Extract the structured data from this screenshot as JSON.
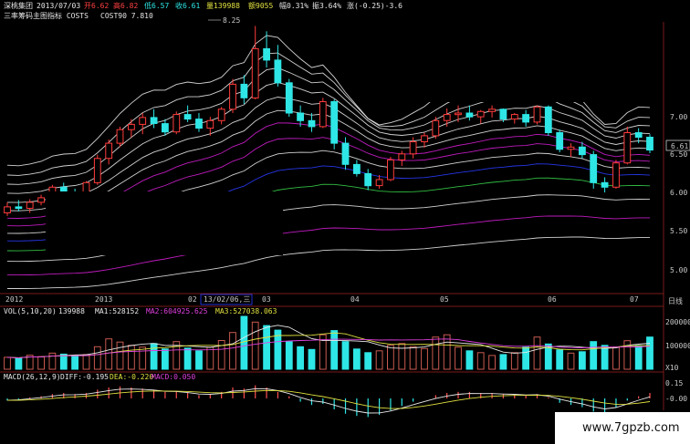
{
  "header": {
    "stock_name": "深桃集团",
    "date": "2013/07/03",
    "open": "开6.62",
    "high": "高6.82",
    "low": "低6.57",
    "close": "收6.61",
    "volume": "量139988",
    "amount": "额9055",
    "change": "幅0.31%",
    "amplitude": "振3.64%",
    "change_amt": "涨(-0.25)-3.6",
    "indicator_title": "三率筹码主图指标 COSTS",
    "cost_value": "COST90 7.810"
  },
  "price_panel": {
    "y_ticks": [
      "7.00",
      "6.50",
      "6.00",
      "5.50",
      "5.00"
    ],
    "current_price": "6.61",
    "peak_label": "8.25",
    "axis_label": "日线",
    "colors": {
      "up": "#ff3b3b",
      "down": "#2ee6e6",
      "ribbon_white": "#e8e8e8",
      "ribbon_magenta": "#d21ed2",
      "ribbon_blue": "#2a3cff",
      "ribbon_green": "#37d14a"
    }
  },
  "time_axis": {
    "labels": [
      "2012",
      "2013",
      "02",
      "13/02/06,三",
      "03",
      "04",
      "05",
      "06",
      "07"
    ]
  },
  "volume_panel": {
    "legend": {
      "label": "VOL(5,10,20)",
      "vol": "139988",
      "ma1": "MA1:528152",
      "ma2": "MA2:604925.625",
      "ma3": "MA3:527038.063"
    },
    "y_ticks": [
      "200000",
      "100000",
      "X10"
    ]
  },
  "macd_panel": {
    "legend": {
      "label": "MACD(26,12,9)",
      "diff": "DIFF:-0.195",
      "dea": "DEA:-0.220",
      "macd": "MACD:0.050"
    },
    "y_ticks": [
      "0.15",
      "-0.00"
    ]
  },
  "watermark": "www.7gpzb.com",
  "chart_data": [
    {
      "type": "candlestick",
      "title": "三率筹码主图指标 COSTS",
      "ylim": [
        4.75,
        7.55
      ],
      "ohlc": [
        [
          5.78,
          5.92,
          5.74,
          5.86
        ],
        [
          5.86,
          5.95,
          5.8,
          5.84
        ],
        [
          5.84,
          5.96,
          5.78,
          5.92
        ],
        [
          5.92,
          6.02,
          5.88,
          5.98
        ],
        [
          5.98,
          6.15,
          5.94,
          6.12
        ],
        [
          6.12,
          6.18,
          6.02,
          6.06
        ],
        [
          6.05,
          6.1,
          5.96,
          6.03
        ],
        [
          6.03,
          6.2,
          6.0,
          6.18
        ],
        [
          6.18,
          6.55,
          6.15,
          6.5
        ],
        [
          6.5,
          6.75,
          6.42,
          6.7
        ],
        [
          6.7,
          6.92,
          6.65,
          6.88
        ],
        [
          6.88,
          7.02,
          6.78,
          6.95
        ],
        [
          6.95,
          7.1,
          6.82,
          7.04
        ],
        [
          7.04,
          7.15,
          6.9,
          6.96
        ],
        [
          6.96,
          7.02,
          6.8,
          6.85
        ],
        [
          6.85,
          7.12,
          6.82,
          7.08
        ],
        [
          7.08,
          7.2,
          6.98,
          7.02
        ],
        [
          7.02,
          7.1,
          6.85,
          6.9
        ],
        [
          6.9,
          7.05,
          6.8,
          7.0
        ],
        [
          7.0,
          7.18,
          6.95,
          7.15
        ],
        [
          7.15,
          7.55,
          7.1,
          7.48
        ],
        [
          7.48,
          7.6,
          7.22,
          7.3
        ],
        [
          7.3,
          8.25,
          7.28,
          7.95
        ],
        [
          7.95,
          8.18,
          7.7,
          7.8
        ],
        [
          7.8,
          8.0,
          7.45,
          7.5
        ],
        [
          7.5,
          7.55,
          7.05,
          7.1
        ],
        [
          7.1,
          7.2,
          6.92,
          7.0
        ],
        [
          7.0,
          7.1,
          6.85,
          6.92
        ],
        [
          6.92,
          7.3,
          6.9,
          7.25
        ],
        [
          7.25,
          7.28,
          6.62,
          6.7
        ],
        [
          6.7,
          6.78,
          6.35,
          6.42
        ],
        [
          6.42,
          6.48,
          6.26,
          6.3
        ],
        [
          6.3,
          6.36,
          6.08,
          6.14
        ],
        [
          6.14,
          6.28,
          6.1,
          6.22
        ],
        [
          6.22,
          6.52,
          6.2,
          6.48
        ],
        [
          6.48,
          6.6,
          6.4,
          6.56
        ],
        [
          6.56,
          6.78,
          6.5,
          6.72
        ],
        [
          6.72,
          6.84,
          6.64,
          6.8
        ],
        [
          6.8,
          7.05,
          6.76,
          7.0
        ],
        [
          7.0,
          7.16,
          6.92,
          7.08
        ],
        [
          7.08,
          7.2,
          6.98,
          7.1
        ],
        [
          7.1,
          7.2,
          7.0,
          7.05
        ],
        [
          7.05,
          7.14,
          6.96,
          7.12
        ],
        [
          7.12,
          7.2,
          7.04,
          7.15
        ],
        [
          7.15,
          7.16,
          6.98,
          7.02
        ],
        [
          7.02,
          7.1,
          6.96,
          7.08
        ],
        [
          7.08,
          7.14,
          6.92,
          6.98
        ],
        [
          6.98,
          7.2,
          6.95,
          7.18
        ],
        [
          7.18,
          7.2,
          6.8,
          6.84
        ],
        [
          6.84,
          6.88,
          6.58,
          6.62
        ],
        [
          6.62,
          6.7,
          6.52,
          6.65
        ],
        [
          6.65,
          6.72,
          6.5,
          6.55
        ],
        [
          6.55,
          6.6,
          6.1,
          6.18
        ],
        [
          6.18,
          6.25,
          6.05,
          6.12
        ],
        [
          6.12,
          6.48,
          6.1,
          6.44
        ],
        [
          6.44,
          6.92,
          6.42,
          6.84
        ],
        [
          6.84,
          6.9,
          6.7,
          6.78
        ],
        [
          6.78,
          6.82,
          6.57,
          6.61
        ]
      ]
    },
    {
      "type": "bar",
      "title": "VOL(5,10,20)",
      "values": [
        52000,
        48000,
        61000,
        55000,
        70000,
        66000,
        60000,
        64000,
        98000,
        132000,
        118000,
        104000,
        96000,
        112000,
        88000,
        120000,
        92000,
        80000,
        96000,
        125000,
        160000,
        230000,
        205000,
        190000,
        170000,
        120000,
        98000,
        86000,
        150000,
        168000,
        120000,
        88000,
        72000,
        80000,
        104000,
        112000,
        98000,
        90000,
        140000,
        150000,
        96000,
        80000,
        72000,
        60000,
        64000,
        72000,
        96000,
        140000,
        110000,
        84000,
        70000,
        76000,
        120000,
        104000,
        96000,
        124000,
        102000,
        139988
      ],
      "up": [
        1,
        0,
        1,
        1,
        1,
        0,
        0,
        1,
        1,
        1,
        1,
        1,
        1,
        0,
        0,
        1,
        0,
        0,
        1,
        1,
        1,
        0,
        1,
        0,
        0,
        0,
        0,
        0,
        1,
        0,
        0,
        0,
        0,
        1,
        1,
        1,
        1,
        1,
        1,
        1,
        1,
        0,
        1,
        1,
        0,
        1,
        0,
        1,
        0,
        0,
        1,
        0,
        0,
        0,
        1,
        1,
        0,
        0
      ],
      "ylim": [
        0,
        230000
      ]
    },
    {
      "type": "bar",
      "title": "MACD(26,12,9)",
      "values": [
        -0.02,
        -0.01,
        0.01,
        0.02,
        0.04,
        0.05,
        0.04,
        0.05,
        0.08,
        0.1,
        0.11,
        0.1,
        0.09,
        0.08,
        0.06,
        0.07,
        0.05,
        0.03,
        0.04,
        0.06,
        0.1,
        0.09,
        0.12,
        0.1,
        0.06,
        0.02,
        -0.03,
        -0.06,
        -0.05,
        -0.1,
        -0.14,
        -0.16,
        -0.17,
        -0.15,
        -0.11,
        -0.07,
        -0.03,
        0.0,
        0.03,
        0.05,
        0.06,
        0.06,
        0.05,
        0.05,
        0.04,
        0.04,
        0.03,
        0.04,
        0.01,
        -0.04,
        -0.06,
        -0.08,
        -0.12,
        -0.13,
        -0.08,
        -0.02,
        0.02,
        0.05
      ],
      "ylim": [
        -0.2,
        0.18
      ]
    }
  ]
}
